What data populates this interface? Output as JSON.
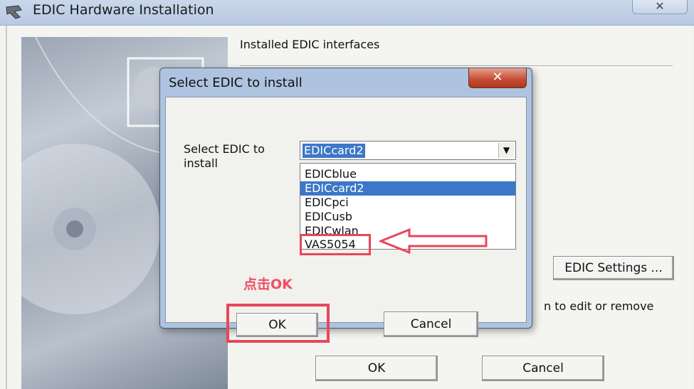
{
  "window": {
    "title": "EDIC Hardware Installation",
    "close_glyph": "✕",
    "icon": "app-icon"
  },
  "main": {
    "installed_label": "Installed EDIC interfaces",
    "edic_settings_label": "EDIC Settings ...",
    "edit_hint": "n to edit or remove",
    "ok_label": "OK",
    "cancel_label": "Cancel"
  },
  "dialog": {
    "title": "Select EDIC to install",
    "close_glyph": "✕",
    "select_label_line1": "Select EDIC to",
    "select_label_line2": "install",
    "selected_value": "EDICcard2",
    "dropdown_glyph": "▼",
    "options": [
      "EDICblue",
      "EDICcard2",
      "EDICpci",
      "EDICusb",
      "EDICwlan",
      "VAS5054"
    ],
    "highlighted_option": "EDICcard2",
    "ok_label": "OK",
    "cancel_label": "Cancel"
  },
  "annotation": {
    "text": "点击OK",
    "color": "#ef4f60"
  },
  "colors": {
    "selection": "#3d77c9",
    "dialog_frame": "#aec3df",
    "close_button": "#c44a32"
  }
}
